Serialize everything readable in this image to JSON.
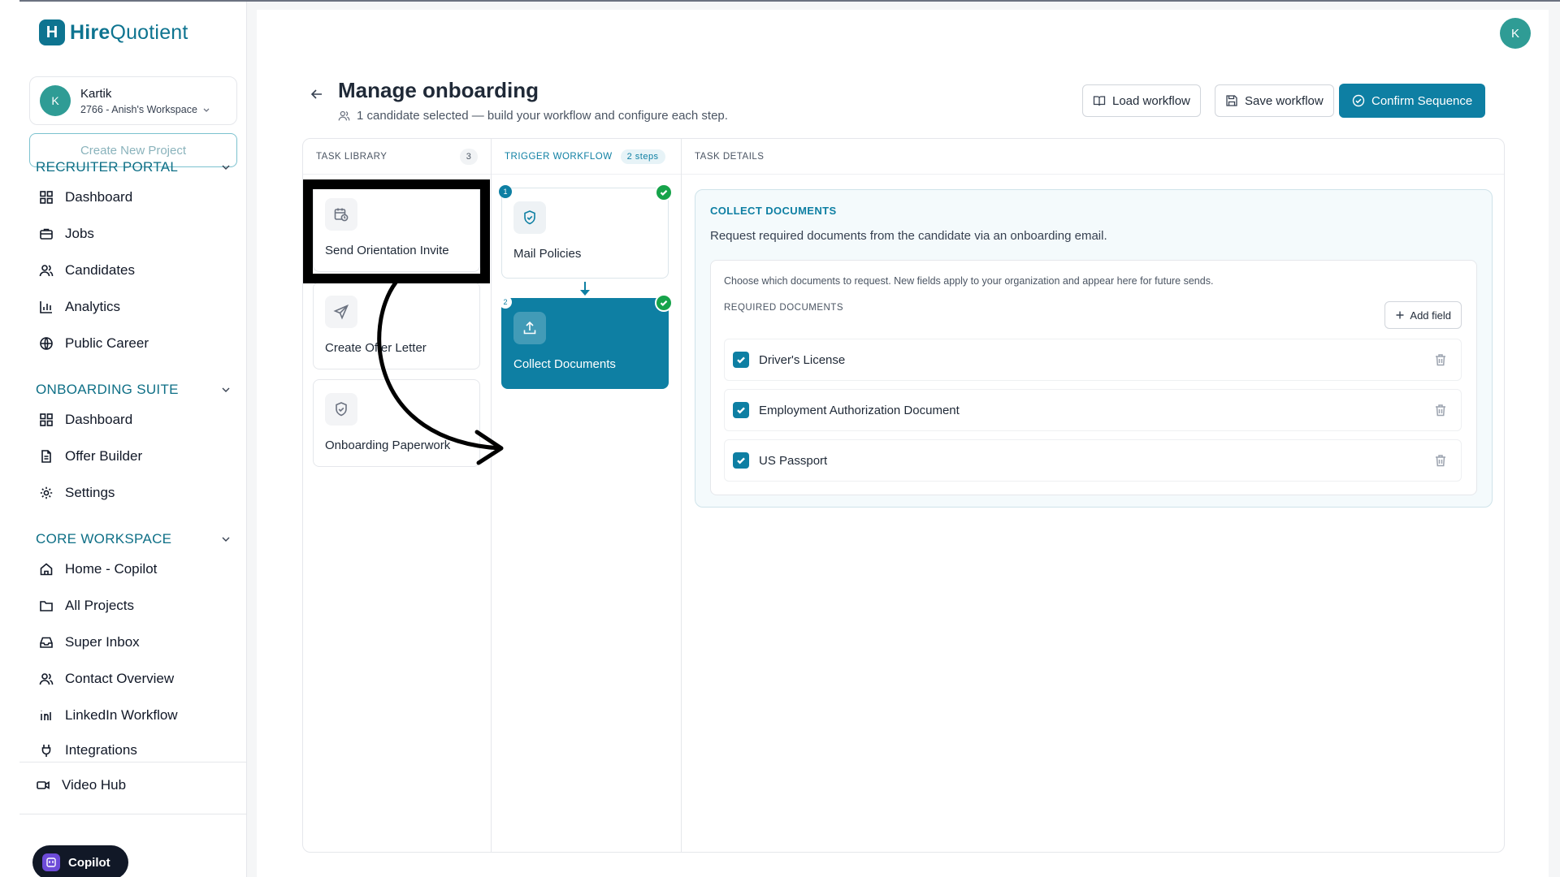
{
  "brand": {
    "mark": "H",
    "name_bold": "Hire",
    "name_rest": "Quotient"
  },
  "workspace": {
    "avatar": "K",
    "name": "Kartik",
    "subtitle": "2766 - Anish's Workspace"
  },
  "create_project_label": "Create New Project",
  "sidebar": {
    "sections": [
      {
        "title": "RECRUITER PORTAL",
        "items": [
          "Dashboard",
          "Jobs",
          "Candidates",
          "Analytics",
          "Public Career"
        ]
      },
      {
        "title": "ONBOARDING SUITE",
        "items": [
          "Dashboard",
          "Offer Builder",
          "Settings"
        ]
      },
      {
        "title": "CORE WORKSPACE",
        "items": [
          "Home - Copilot",
          "All Projects",
          "Super Inbox",
          "Contact Overview",
          "LinkedIn Workflow",
          "Integrations"
        ]
      }
    ],
    "footer_item": "Video Hub",
    "copilot_label": "Copilot"
  },
  "topbar": {
    "avatar": "K"
  },
  "page": {
    "title": "Manage onboarding",
    "subtitle": "1 candidate selected — build your workflow and configure each step."
  },
  "actions": {
    "load": "Load workflow",
    "save": "Save workflow",
    "confirm": "Confirm Sequence"
  },
  "library": {
    "heading": "TASK LIBRARY",
    "count": "3",
    "tasks": [
      {
        "label": "Send Orientation Invite",
        "icon": "calendar-clock-icon"
      },
      {
        "label": "Create Offer Letter",
        "icon": "send-icon"
      },
      {
        "label": "Onboarding Paperwork",
        "icon": "shield-check-icon"
      }
    ]
  },
  "trigger": {
    "heading": "TRIGGER WORKFLOW",
    "steps_badge": "2 steps",
    "steps": [
      {
        "num": "1",
        "label": "Mail Policies",
        "icon": "shield-check-icon"
      },
      {
        "num": "2",
        "label": "Collect Documents",
        "icon": "upload-icon",
        "active": true
      }
    ]
  },
  "details": {
    "heading": "TASK DETAILS",
    "title": "COLLECT DOCUMENTS",
    "description": "Request required documents from the candidate via an onboarding email.",
    "note": "Choose which documents to request. New fields apply to your organization and appear here for future sends.",
    "required_label": "REQUIRED DOCUMENTS",
    "add_field": "Add field",
    "documents": [
      "Driver's License",
      "Employment Authorization Document",
      "US Passport"
    ]
  },
  "colors": {
    "accent": "#0e7fa3",
    "brand": "#0e7490",
    "success": "#16a34a"
  }
}
